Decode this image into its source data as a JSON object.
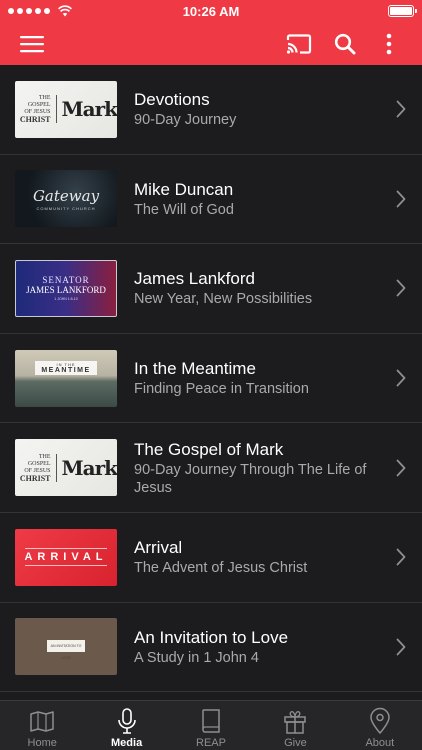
{
  "status_bar": {
    "time": "10:26 AM",
    "signal_dots": 5,
    "battery_level": 1.0
  },
  "nav_bar": {
    "background_color": "#ef3a45",
    "icons": [
      "hamburger-menu-icon",
      "cast-icon",
      "search-icon",
      "more-vertical-icon"
    ]
  },
  "media_list": [
    {
      "title": "Devotions",
      "subtitle": "90-Day Journey",
      "thumbnail": {
        "style": "mark",
        "lines": [
          "THE GOSPEL",
          "OF JESUS",
          "CHRIST",
          "Mark"
        ]
      }
    },
    {
      "title": "Mike Duncan",
      "subtitle": "The Will of God",
      "thumbnail": {
        "style": "gateway",
        "lines": [
          "Gateway",
          "COMMUNITY CHURCH"
        ]
      }
    },
    {
      "title": "James Lankford",
      "subtitle": "New Year, New Possibilities",
      "thumbnail": {
        "style": "senator",
        "lines": [
          "SENATOR",
          "JAMES LANKFORD",
          "1 JOHN 1:5-10"
        ]
      }
    },
    {
      "title": "In the Meantime",
      "subtitle": "Finding Peace in Transition",
      "thumbnail": {
        "style": "meantime",
        "lines": [
          "IN THE",
          "MEANTIME"
        ]
      }
    },
    {
      "title": "The Gospel of Mark",
      "subtitle": "90-Day Journey Through The Life of Jesus",
      "thumbnail": {
        "style": "mark",
        "lines": [
          "THE GOSPEL",
          "OF JESUS",
          "CHRIST",
          "Mark"
        ]
      }
    },
    {
      "title": "Arrival",
      "subtitle": "The Advent of Jesus Christ",
      "thumbnail": {
        "style": "arrival",
        "lines": [
          "ARRIVAL"
        ]
      }
    },
    {
      "title": "An Invitation to Love",
      "subtitle": "A Study in 1 John 4",
      "thumbnail": {
        "style": "love",
        "lines": [
          "AN INVITATION TO LOVE"
        ]
      }
    }
  ],
  "tab_bar": {
    "active": "Media",
    "tabs": [
      {
        "label": "Home",
        "icon": "book-map-icon"
      },
      {
        "label": "Media",
        "icon": "microphone-icon"
      },
      {
        "label": "REAP",
        "icon": "bible-icon"
      },
      {
        "label": "Give",
        "icon": "gift-icon"
      },
      {
        "label": "About",
        "icon": "location-pin-icon"
      }
    ]
  }
}
